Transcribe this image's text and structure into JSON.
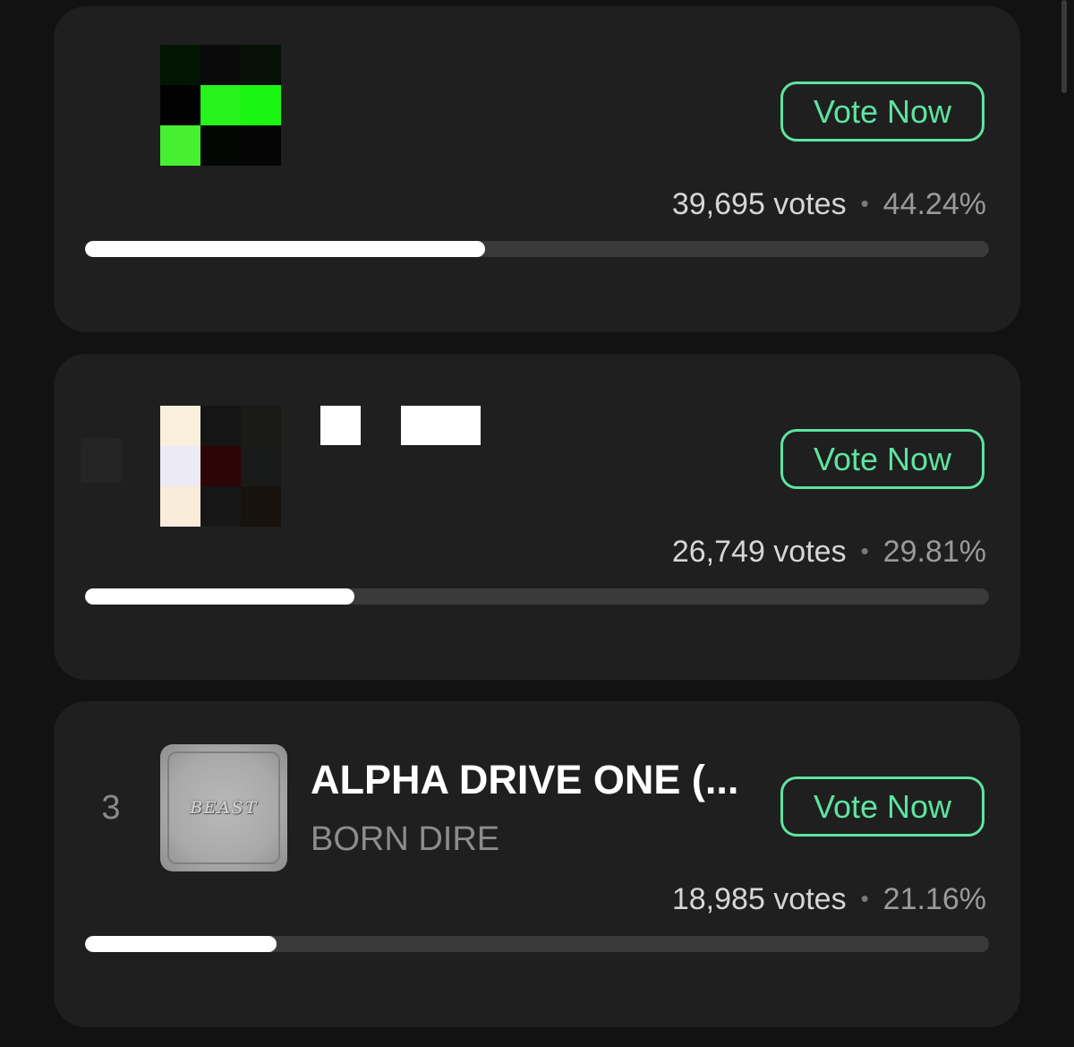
{
  "vote_button_label": "Vote Now",
  "entries": [
    {
      "rank": "",
      "title": "",
      "artist": "",
      "votes": "39,695 votes",
      "percent": "44.24%",
      "share": 0.4424,
      "art_cells": [
        "#031503",
        "#0a0a0a",
        "#061006",
        "#020202",
        "#27f31d",
        "#1bf512",
        "#46f031",
        "#030703",
        "#060506"
      ]
    },
    {
      "rank": "",
      "title": "",
      "artist": "",
      "votes": "26,749 votes",
      "percent": "29.81%",
      "share": 0.2981,
      "art_cells": [
        "#f8f0dc",
        "#151515",
        "#1a1a17",
        "#ebeaf5",
        "#2b0605",
        "#191a1a",
        "#faecdb",
        "#171717",
        "#17120d"
      ]
    },
    {
      "rank": "3",
      "title": "ALPHA DRIVE ONE (...",
      "artist": "BORN DIRE",
      "votes": "18,985 votes",
      "percent": "21.16%",
      "share": 0.2116
    }
  ],
  "colors": {
    "background": "#121212",
    "card": "#1f1f1f",
    "accent": "#5ee3a0",
    "bar_track": "#3a3a3a",
    "bar_fill": "#ffffff"
  }
}
